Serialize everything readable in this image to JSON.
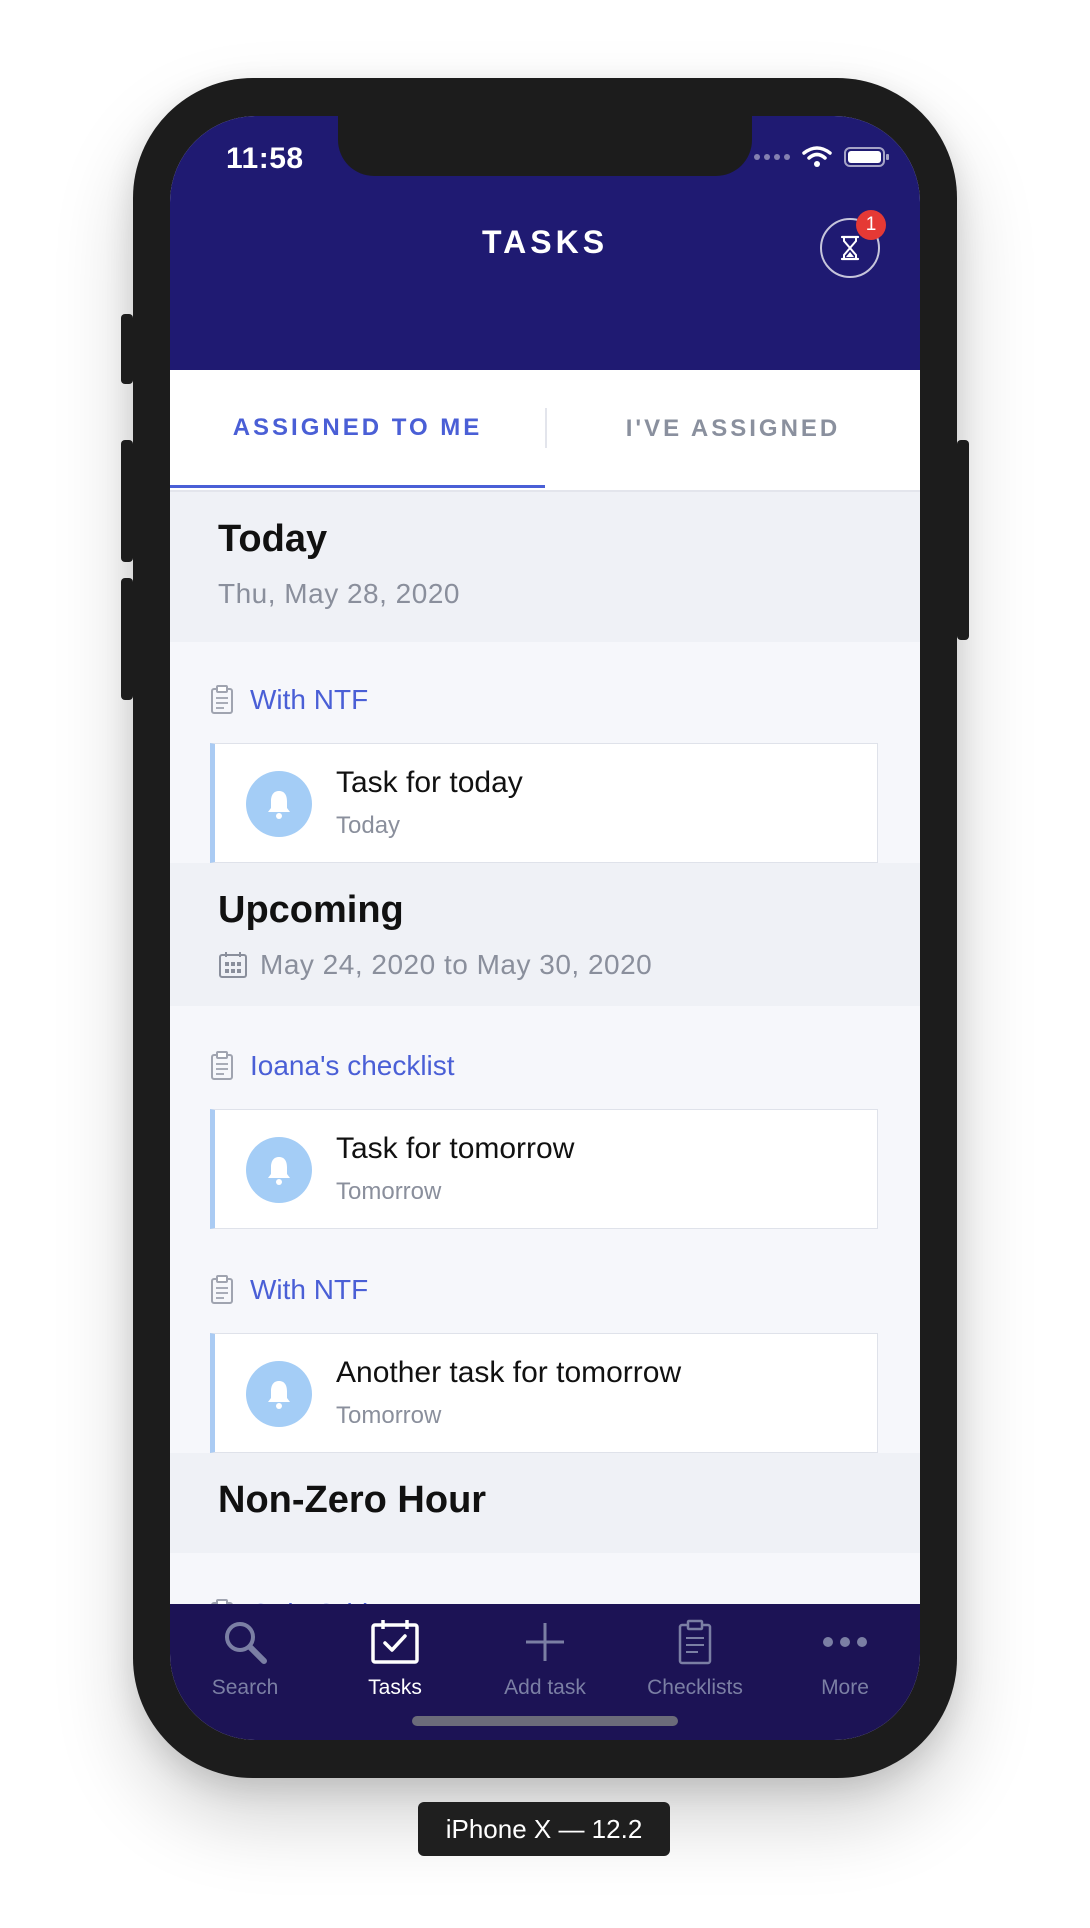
{
  "status_bar": {
    "time": "11:58"
  },
  "header": {
    "title": "TASKS",
    "timer_badge": "1"
  },
  "tabs": [
    {
      "label": "ASSIGNED TO ME",
      "active": true
    },
    {
      "label": "I'VE ASSIGNED",
      "active": false
    }
  ],
  "sections": {
    "today": {
      "title": "Today",
      "date": "Thu, May 28, 2020"
    },
    "upcoming": {
      "title": "Upcoming",
      "date_range": "May 24, 2020 to May 30, 2020"
    },
    "non_zero": {
      "title": "Non-Zero Hour"
    }
  },
  "groups": [
    {
      "label": "With NTF"
    },
    {
      "label": "Ioana's checklist"
    },
    {
      "label": "With NTF"
    },
    {
      "label": "Only Grid"
    }
  ],
  "tasks": [
    {
      "title": "Task for today",
      "due": "Today"
    },
    {
      "title": "Task for tomorrow",
      "due": "Tomorrow"
    },
    {
      "title": "Another task for tomorrow",
      "due": "Tomorrow"
    }
  ],
  "tab_bar": [
    {
      "label": "Search",
      "icon": "search-icon"
    },
    {
      "label": "Tasks",
      "icon": "calendar-check-icon",
      "active": true
    },
    {
      "label": "Add task",
      "icon": "plus-icon"
    },
    {
      "label": "Checklists",
      "icon": "clipboard-icon"
    },
    {
      "label": "More",
      "icon": "more-icon"
    }
  ],
  "device_caption": "iPhone X — 12.2",
  "colors": {
    "header_bg": "#1f1a72",
    "accent": "#4a5fd6",
    "tabbar_bg": "#1c1355",
    "badge": "#e53935",
    "bell_bg": "#a4cdf6"
  }
}
